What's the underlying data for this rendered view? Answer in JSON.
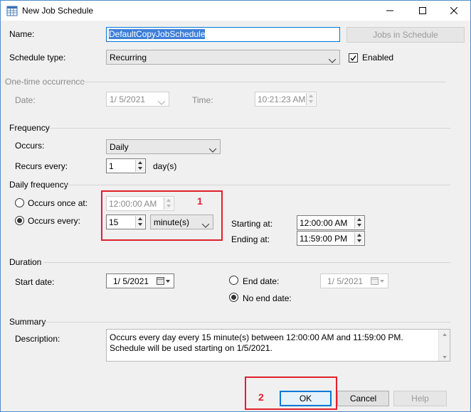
{
  "window": {
    "title": "New Job Schedule"
  },
  "name": {
    "label": "Name:",
    "value": "DefaultCopyJobSchedule"
  },
  "jobs_button": "Jobs in Schedule",
  "schedule_type": {
    "label": "Schedule type:",
    "value": "Recurring",
    "enabled_label": "Enabled"
  },
  "one_time": {
    "group": "One-time occurrence",
    "date_label": "Date:",
    "date": "1/  5/2021",
    "time_label": "Time:",
    "time": "10:21:23 AM"
  },
  "frequency": {
    "group": "Frequency",
    "occurs_label": "Occurs:",
    "occurs": "Daily",
    "recurs_label": "Recurs every:",
    "recurs_value": "1",
    "recurs_unit": "day(s)"
  },
  "daily": {
    "group": "Daily frequency",
    "once_label": "Occurs once at:",
    "once_time": "12:00:00 AM",
    "every_label": "Occurs every:",
    "every_value": "15",
    "every_unit": "minute(s)",
    "starting_label": "Starting at:",
    "starting": "12:00:00 AM",
    "ending_label": "Ending at:",
    "ending": "11:59:00 PM"
  },
  "duration": {
    "group": "Duration",
    "start_label": "Start date:",
    "start": "1/  5/2021",
    "end_label": "End date:",
    "end": "1/  5/2021",
    "no_end_label": "No end date:"
  },
  "summary": {
    "group": "Summary",
    "desc_label": "Description:",
    "description": "Occurs every day every 15 minute(s) between 12:00:00 AM and 11:59:00 PM. Schedule will be used starting on 1/5/2021."
  },
  "buttons": {
    "ok": "OK",
    "cancel": "Cancel",
    "help": "Help"
  },
  "annotations": {
    "one": "1",
    "two": "2"
  },
  "colors": {
    "accent": "#0078d7",
    "annotation": "#e0202a"
  }
}
